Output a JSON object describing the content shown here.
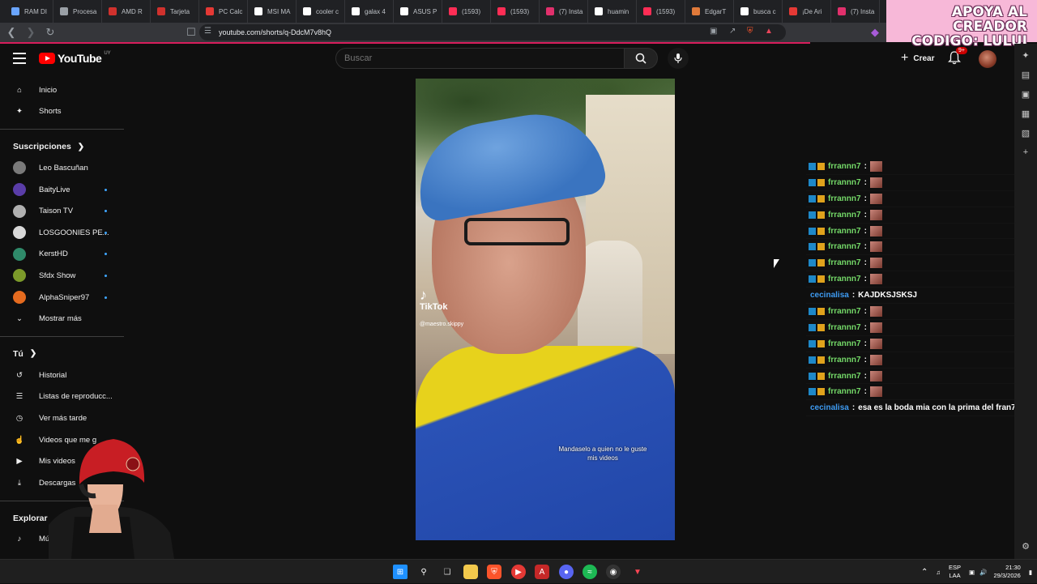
{
  "browser": {
    "tabs": [
      {
        "title": "RAM DI",
        "color": "#6aa5ff"
      },
      {
        "title": "Procesa",
        "color": "#9aa0a6"
      },
      {
        "title": "AMD R",
        "color": "#d0312d"
      },
      {
        "title": "Tarjeta",
        "color": "#d0312d"
      },
      {
        "title": "PC Calc",
        "color": "#e53935"
      },
      {
        "title": "MSI MA",
        "color": "#ffffff"
      },
      {
        "title": "cooler c",
        "color": "#ffffff"
      },
      {
        "title": "galax 4",
        "color": "#ffffff"
      },
      {
        "title": "ASUS P",
        "color": "#ffffff"
      },
      {
        "title": "(1593)",
        "color": "#ff2d55"
      },
      {
        "title": "(1593)",
        "color": "#ff2d55"
      },
      {
        "title": "(7) Insta",
        "color": "#e1306c"
      },
      {
        "title": "huamin",
        "color": "#ffffff"
      },
      {
        "title": "(1593)",
        "color": "#ff2d55"
      },
      {
        "title": "EdgarT",
        "color": "#e07a3a"
      },
      {
        "title": "busca c",
        "color": "#ffffff"
      },
      {
        "title": "¡De Ari",
        "color": "#e53935"
      },
      {
        "title": "(7) Insta",
        "color": "#e1306c"
      }
    ],
    "url": "youtube.com/shorts/q-DdcM7v8hQ",
    "promo_line1": "APOYA AL CREADOR",
    "promo_line2": "CODIGO: LULUI",
    "accent_color": "#d71e5c"
  },
  "masthead": {
    "logo_text": "YouTube",
    "country_code": "UY",
    "search_placeholder": "Buscar",
    "create_label": "Crear",
    "notification_count": "9+"
  },
  "sidebar": {
    "main": [
      {
        "label": "Inicio",
        "icon": "home-icon"
      },
      {
        "label": "Shorts",
        "icon": "shorts-icon"
      }
    ],
    "subscriptions_header": "Suscripciones",
    "subscriptions": [
      {
        "label": "Leo Bascuñan",
        "new": false,
        "color": "#7a7a7a"
      },
      {
        "label": "BaityLive",
        "new": true,
        "color": "#5a3da8"
      },
      {
        "label": "Taison TV",
        "new": true,
        "color": "#b0b0b0"
      },
      {
        "label": "LOSGOONIES PE...",
        "new": true,
        "color": "#d8d8d8"
      },
      {
        "label": "KerstHD",
        "new": true,
        "color": "#2f8a6a"
      },
      {
        "label": "Sfdx Show",
        "new": true,
        "color": "#7c9a2a"
      },
      {
        "label": "AlphaSniper97",
        "new": true,
        "color": "#e56b1f"
      }
    ],
    "show_more": "Mostrar más",
    "you_header": "Tú",
    "you_items": [
      {
        "label": "Historial",
        "icon": "history-icon"
      },
      {
        "label": "Listas de reproducc...",
        "icon": "playlist-icon"
      },
      {
        "label": "Ver más tarde",
        "icon": "clock-icon"
      },
      {
        "label": "Videos que me g",
        "icon": "like-icon"
      },
      {
        "label": "Mis videos",
        "icon": "my-videos-icon"
      },
      {
        "label": "Descargas",
        "icon": "download-icon"
      }
    ],
    "explore_header": "Explorar",
    "explore_items": [
      {
        "label": "Músi",
        "icon": "music-icon"
      }
    ]
  },
  "short": {
    "watermark": "TikTok",
    "handle": "@maestro.skippy",
    "caption": "Mandaselo a quien no le guste mis videos"
  },
  "chat": [
    {
      "user": "frrannn7",
      "message": "",
      "emote": true
    },
    {
      "user": "frrannn7",
      "message": "",
      "emote": true
    },
    {
      "user": "frrannn7",
      "message": "",
      "emote": true
    },
    {
      "user": "frrannn7",
      "message": "",
      "emote": true
    },
    {
      "user": "frrannn7",
      "message": "",
      "emote": true
    },
    {
      "user": "frrannn7",
      "message": "",
      "emote": true
    },
    {
      "user": "frrannn7",
      "message": "",
      "emote": true
    },
    {
      "user": "frrannn7",
      "message": "",
      "emote": true
    },
    {
      "user": "cecinalisa",
      "message": "KAJDKSJSKSJ",
      "emote": false
    },
    {
      "user": "frrannn7",
      "message": "",
      "emote": true
    },
    {
      "user": "frrannn7",
      "message": "",
      "emote": true
    },
    {
      "user": "frrannn7",
      "message": "",
      "emote": true
    },
    {
      "user": "frrannn7",
      "message": "",
      "emote": true
    },
    {
      "user": "frrannn7",
      "message": "",
      "emote": true
    },
    {
      "user": "frrannn7",
      "message": "",
      "emote": true
    },
    {
      "user": "cecinalisa",
      "message": "esa es la boda mia con la prima del fran7",
      "emote": false
    }
  ],
  "taskbar": {
    "lang_line1": "ESP",
    "lang_line2": "LAA",
    "time": "21:30",
    "date": "29/3/2026"
  }
}
